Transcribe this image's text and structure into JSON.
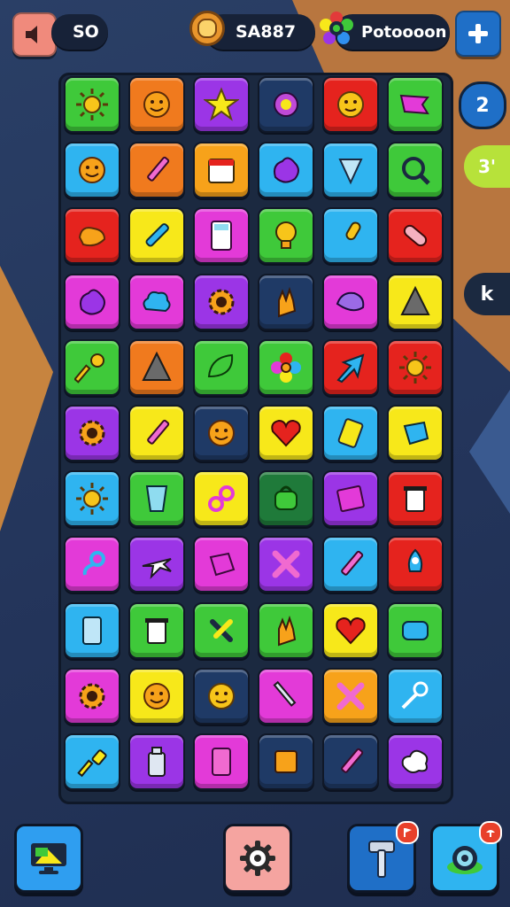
{
  "hud": {
    "sound_value": "SO",
    "coins_value": "SA887",
    "powerup_value": "Potoooon"
  },
  "side": {
    "level_badge": "2",
    "bonus_badge": "3'",
    "k_badge": "k"
  },
  "colors": {
    "background": "#26385c",
    "accent_orange": "#e07a3a",
    "plus_button": "#1f6fc7"
  },
  "board": {
    "rows": [
      [
        {
          "color": "#3fc93a",
          "icon": "sun-icon"
        },
        {
          "color": "#f07a1e",
          "icon": "sun-face-icon"
        },
        {
          "color": "#9b35e6",
          "icon": "star-icon"
        },
        {
          "color": "#1f3a66",
          "icon": "gear-gem-icon"
        },
        {
          "color": "#e5231e",
          "icon": "face-icon"
        },
        {
          "color": "#3fc93a",
          "icon": "pennant-icon"
        }
      ],
      [
        {
          "color": "#2fb4f0",
          "icon": "sun-face-icon"
        },
        {
          "color": "#f07a1e",
          "icon": "pencil-icon"
        },
        {
          "color": "#f7a21a",
          "icon": "calendar-icon"
        },
        {
          "color": "#2fb4f0",
          "icon": "blob-icon"
        },
        {
          "color": "#2fb4f0",
          "icon": "cone-icon"
        },
        {
          "color": "#3fc93a",
          "icon": "magnifier-icon"
        }
      ],
      [
        {
          "color": "#e5231e",
          "icon": "bird-icon"
        },
        {
          "color": "#f7e81a",
          "icon": "pin-icon"
        },
        {
          "color": "#e33ad8",
          "icon": "calculator-icon"
        },
        {
          "color": "#3fc93a",
          "icon": "bulb-icon"
        },
        {
          "color": "#2fb4f0",
          "icon": "microphone-icon"
        },
        {
          "color": "#e5231e",
          "icon": "bandage-icon"
        }
      ],
      [
        {
          "color": "#e33ad8",
          "icon": "blob-icon"
        },
        {
          "color": "#e33ad8",
          "icon": "cloud-icon"
        },
        {
          "color": "#9b35e6",
          "icon": "gear-icon"
        },
        {
          "color": "#1f3a66",
          "icon": "hand-icon"
        },
        {
          "color": "#e33ad8",
          "icon": "rock-icon"
        },
        {
          "color": "#f7e81a",
          "icon": "triangle-icon"
        }
      ],
      [
        {
          "color": "#3fc93a",
          "icon": "key-icon"
        },
        {
          "color": "#f07a1e",
          "icon": "triangle-icon"
        },
        {
          "color": "#3fc93a",
          "icon": "leaf-icon"
        },
        {
          "color": "#3fc93a",
          "icon": "flower-icon"
        },
        {
          "color": "#e5231e",
          "icon": "arrow-icon"
        },
        {
          "color": "#e5231e",
          "icon": "sun-icon"
        }
      ],
      [
        {
          "color": "#9b35e6",
          "icon": "gear-icon"
        },
        {
          "color": "#f7e81a",
          "icon": "pencil-icon"
        },
        {
          "color": "#1f3a66",
          "icon": "sun-face-icon"
        },
        {
          "color": "#f7e81a",
          "icon": "heart-icon"
        },
        {
          "color": "#2fb4f0",
          "icon": "battery-icon"
        },
        {
          "color": "#f7e81a",
          "icon": "gem-icon"
        }
      ],
      [
        {
          "color": "#2fb4f0",
          "icon": "sun-icon"
        },
        {
          "color": "#3fc93a",
          "icon": "cup-icon"
        },
        {
          "color": "#f7e81a",
          "icon": "link-icon"
        },
        {
          "color": "#1f7a3a",
          "icon": "bag-icon"
        },
        {
          "color": "#9b35e6",
          "icon": "book-icon"
        },
        {
          "color": "#e5231e",
          "icon": "trash-icon"
        }
      ],
      [
        {
          "color": "#e33ad8",
          "icon": "chain-icon"
        },
        {
          "color": "#9b35e6",
          "icon": "plane-icon"
        },
        {
          "color": "#e33ad8",
          "icon": "cube-icon"
        },
        {
          "color": "#9b35e6",
          "icon": "cross-icon"
        },
        {
          "color": "#2fb4f0",
          "icon": "pencil-icon"
        },
        {
          "color": "#e5231e",
          "icon": "rocket-icon"
        }
      ],
      [
        {
          "color": "#2fb4f0",
          "icon": "door-icon"
        },
        {
          "color": "#3fc93a",
          "icon": "trash-icon"
        },
        {
          "color": "#3fc93a",
          "icon": "tools-icon"
        },
        {
          "color": "#3fc93a",
          "icon": "hand-icon"
        },
        {
          "color": "#f7e81a",
          "icon": "heart-icon"
        },
        {
          "color": "#3fc93a",
          "icon": "sponge-icon"
        }
      ],
      [
        {
          "color": "#e33ad8",
          "icon": "gear-icon"
        },
        {
          "color": "#f7e81a",
          "icon": "sun-face-icon"
        },
        {
          "color": "#1f3a66",
          "icon": "face-icon"
        },
        {
          "color": "#e33ad8",
          "icon": "sword-icon"
        },
        {
          "color": "#f7a21a",
          "icon": "cross-icon"
        },
        {
          "color": "#2fb4f0",
          "icon": "wand-icon"
        }
      ],
      [
        {
          "color": "#2fb4f0",
          "icon": "hammer-icon"
        },
        {
          "color": "#9b35e6",
          "icon": "bottle-icon"
        },
        {
          "color": "#e33ad8",
          "icon": "phone-icon"
        },
        {
          "color": "#1f3a66",
          "icon": "box-icon"
        },
        {
          "color": "#1f3a66",
          "icon": "pencil-icon"
        },
        {
          "color": "#9b35e6",
          "icon": "splat-icon"
        }
      ]
    ]
  }
}
